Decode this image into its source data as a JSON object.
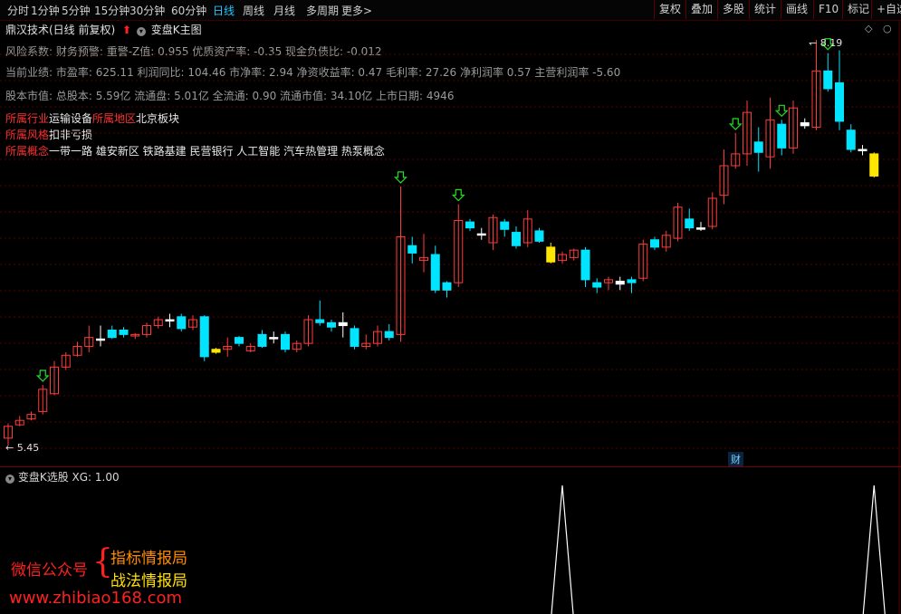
{
  "toolbar": {
    "left": [
      "分时",
      "1分钟",
      "5分钟",
      "15分钟",
      "30分钟",
      "60分钟",
      "日线",
      "周线",
      "月线",
      "多周期",
      "更多>"
    ],
    "active": "日线",
    "right": [
      "复权",
      "叠加",
      "多股",
      "统计",
      "画线",
      "F10",
      "标记",
      "+自选"
    ]
  },
  "main_title": "鼎汉技术(日线 前复权)",
  "indicator_name": "变盘K主图",
  "info": {
    "risk": "风险系数: 财务预警: 重警-Z值: 0.955 优质资产率: -0.35 现金负债比: -0.012",
    "perf": "当前业绩: 市盈率: 625.11 利润同比: 104.46 市净率: 2.94 净资收益率: 0.47 毛利率: 27.26 净利润率 0.57 主营利润率 -5.60",
    "equity": "股本市值: 总股本: 5.59亿 流通盘: 5.01亿 全流通: 0.90 流通市值: 34.10亿 上市日期: 4946"
  },
  "tags": {
    "industry_label": "所属行业",
    "industry": "运输设备",
    "region_label": "所属地区",
    "region": "北京板块",
    "style_label": "所属风格",
    "style": "扣非亏损",
    "concept_label": "所属概念",
    "concept": "一带一路 雄安新区 铁路基建 民营银行 人工智能 汽车热管理 热泵概念"
  },
  "price_high": "8.19",
  "price_low": "5.45",
  "cai_badge": "财",
  "sub_title": "变盘K选股 XG: 1.00",
  "watermark": {
    "wechat": "微信公众号",
    "brace": "{",
    "line1": "指标情报局",
    "line2": "战法情报局",
    "url": "www.zhibiao168.com"
  },
  "colors": {
    "up": "#ff3c3c",
    "down": "#00e4ff",
    "special": "#ffe600",
    "arrow": "#22dd22",
    "bg": "#000000",
    "grid": "#5a0000"
  },
  "chart_data": {
    "type": "candlestick",
    "ylim": [
      5.3,
      8.4
    ],
    "candles": [
      {
        "o": 5.5,
        "c": 5.58,
        "h": 5.6,
        "l": 5.45,
        "t": "up"
      },
      {
        "o": 5.59,
        "c": 5.62,
        "h": 5.65,
        "l": 5.58,
        "t": "up"
      },
      {
        "o": 5.63,
        "c": 5.66,
        "h": 5.68,
        "l": 5.62,
        "t": "up"
      },
      {
        "o": 5.68,
        "c": 5.83,
        "h": 5.86,
        "l": 5.66,
        "t": "up"
      },
      {
        "o": 5.8,
        "c": 5.98,
        "h": 6.02,
        "l": 5.79,
        "t": "up"
      },
      {
        "o": 5.98,
        "c": 6.06,
        "h": 6.08,
        "l": 5.96,
        "t": "up"
      },
      {
        "o": 6.06,
        "c": 6.12,
        "h": 6.15,
        "l": 6.05,
        "t": "up"
      },
      {
        "o": 6.12,
        "c": 6.18,
        "h": 6.26,
        "l": 6.08,
        "t": "up"
      },
      {
        "o": 6.17,
        "c": 6.17,
        "h": 6.26,
        "l": 6.12,
        "t": "flat"
      },
      {
        "o": 6.23,
        "c": 6.18,
        "h": 6.26,
        "l": 6.17,
        "t": "down"
      },
      {
        "o": 6.2,
        "c": 6.23,
        "h": 6.25,
        "l": 6.18,
        "t": "down"
      },
      {
        "o": 6.19,
        "c": 6.2,
        "h": 6.21,
        "l": 6.17,
        "t": "up"
      },
      {
        "o": 6.2,
        "c": 6.26,
        "h": 6.28,
        "l": 6.18,
        "t": "up"
      },
      {
        "o": 6.26,
        "c": 6.3,
        "h": 6.32,
        "l": 6.24,
        "t": "up"
      },
      {
        "o": 6.3,
        "c": 6.3,
        "h": 6.34,
        "l": 6.25,
        "t": "flat"
      },
      {
        "o": 6.32,
        "c": 6.24,
        "h": 6.34,
        "l": 6.22,
        "t": "down"
      },
      {
        "o": 6.25,
        "c": 6.3,
        "h": 6.33,
        "l": 6.23,
        "t": "up"
      },
      {
        "o": 6.32,
        "c": 6.05,
        "h": 6.33,
        "l": 6.02,
        "t": "down"
      },
      {
        "o": 6.08,
        "c": 6.1,
        "h": 6.11,
        "l": 6.07,
        "t": "special"
      },
      {
        "o": 6.1,
        "c": 6.12,
        "h": 6.18,
        "l": 6.05,
        "t": "up"
      },
      {
        "o": 6.18,
        "c": 6.14,
        "h": 6.19,
        "l": 6.12,
        "t": "down"
      },
      {
        "o": 6.09,
        "c": 6.12,
        "h": 6.14,
        "l": 6.08,
        "t": "up"
      },
      {
        "o": 6.2,
        "c": 6.12,
        "h": 6.23,
        "l": 6.11,
        "t": "down"
      },
      {
        "o": 6.18,
        "c": 6.18,
        "h": 6.22,
        "l": 6.14,
        "t": "flat"
      },
      {
        "o": 6.2,
        "c": 6.1,
        "h": 6.22,
        "l": 6.08,
        "t": "down"
      },
      {
        "o": 6.1,
        "c": 6.14,
        "h": 6.16,
        "l": 6.08,
        "t": "up"
      },
      {
        "o": 6.14,
        "c": 6.3,
        "h": 6.33,
        "l": 6.12,
        "t": "up"
      },
      {
        "o": 6.3,
        "c": 6.28,
        "h": 6.43,
        "l": 6.26,
        "t": "down"
      },
      {
        "o": 6.28,
        "c": 6.25,
        "h": 6.3,
        "l": 6.22,
        "t": "down"
      },
      {
        "o": 6.28,
        "c": 6.26,
        "h": 6.35,
        "l": 6.18,
        "t": "flat"
      },
      {
        "o": 6.24,
        "c": 6.12,
        "h": 6.26,
        "l": 6.1,
        "t": "down"
      },
      {
        "o": 6.12,
        "c": 6.14,
        "h": 6.2,
        "l": 6.1,
        "t": "up"
      },
      {
        "o": 6.14,
        "c": 6.22,
        "h": 6.26,
        "l": 6.12,
        "t": "up"
      },
      {
        "o": 6.22,
        "c": 6.18,
        "h": 6.27,
        "l": 6.16,
        "t": "down"
      },
      {
        "o": 6.2,
        "c": 6.86,
        "h": 7.2,
        "l": 6.15,
        "t": "up"
      },
      {
        "o": 6.8,
        "c": 6.75,
        "h": 6.86,
        "l": 6.68,
        "t": "down"
      },
      {
        "o": 6.7,
        "c": 6.72,
        "h": 6.88,
        "l": 6.62,
        "t": "up"
      },
      {
        "o": 6.74,
        "c": 6.5,
        "h": 6.8,
        "l": 6.48,
        "t": "down"
      },
      {
        "o": 6.55,
        "c": 6.5,
        "h": 6.56,
        "l": 6.45,
        "t": "down"
      },
      {
        "o": 6.55,
        "c": 6.97,
        "h": 7.08,
        "l": 6.52,
        "t": "up"
      },
      {
        "o": 6.96,
        "c": 6.92,
        "h": 6.98,
        "l": 6.9,
        "t": "down"
      },
      {
        "o": 6.88,
        "c": 6.88,
        "h": 6.92,
        "l": 6.84,
        "t": "flat"
      },
      {
        "o": 6.82,
        "c": 6.99,
        "h": 7.01,
        "l": 6.77,
        "t": "up"
      },
      {
        "o": 6.96,
        "c": 6.91,
        "h": 6.98,
        "l": 6.86,
        "t": "down"
      },
      {
        "o": 6.89,
        "c": 6.8,
        "h": 6.93,
        "l": 6.78,
        "t": "down"
      },
      {
        "o": 6.82,
        "c": 6.98,
        "h": 7.04,
        "l": 6.79,
        "t": "up"
      },
      {
        "o": 6.9,
        "c": 6.83,
        "h": 6.92,
        "l": 6.82,
        "t": "down"
      },
      {
        "o": 6.79,
        "c": 6.69,
        "h": 6.82,
        "l": 6.68,
        "t": "special"
      },
      {
        "o": 6.7,
        "c": 6.74,
        "h": 6.76,
        "l": 6.68,
        "t": "up"
      },
      {
        "o": 6.72,
        "c": 6.77,
        "h": 6.78,
        "l": 6.7,
        "t": "up"
      },
      {
        "o": 6.77,
        "c": 6.57,
        "h": 6.79,
        "l": 6.52,
        "t": "down"
      },
      {
        "o": 6.55,
        "c": 6.52,
        "h": 6.58,
        "l": 6.48,
        "t": "down"
      },
      {
        "o": 6.55,
        "c": 6.57,
        "h": 6.59,
        "l": 6.5,
        "t": "up"
      },
      {
        "o": 6.56,
        "c": 6.54,
        "h": 6.59,
        "l": 6.5,
        "t": "flat"
      },
      {
        "o": 6.57,
        "c": 6.55,
        "h": 6.59,
        "l": 6.48,
        "t": "down"
      },
      {
        "o": 6.58,
        "c": 6.81,
        "h": 6.84,
        "l": 6.56,
        "t": "up"
      },
      {
        "o": 6.84,
        "c": 6.79,
        "h": 6.86,
        "l": 6.77,
        "t": "down"
      },
      {
        "o": 6.79,
        "c": 6.87,
        "h": 6.9,
        "l": 6.76,
        "t": "up"
      },
      {
        "o": 6.85,
        "c": 7.06,
        "h": 7.09,
        "l": 6.83,
        "t": "up"
      },
      {
        "o": 6.98,
        "c": 6.92,
        "h": 7.05,
        "l": 6.9,
        "t": "down"
      },
      {
        "o": 6.92,
        "c": 6.92,
        "h": 6.96,
        "l": 6.9,
        "t": "flat"
      },
      {
        "o": 6.93,
        "c": 7.12,
        "h": 7.16,
        "l": 6.91,
        "t": "up"
      },
      {
        "o": 7.14,
        "c": 7.34,
        "h": 7.45,
        "l": 7.08,
        "t": "up"
      },
      {
        "o": 7.34,
        "c": 7.42,
        "h": 7.56,
        "l": 7.32,
        "t": "up"
      },
      {
        "o": 7.42,
        "c": 7.7,
        "h": 7.78,
        "l": 7.34,
        "t": "up"
      },
      {
        "o": 7.5,
        "c": 7.43,
        "h": 7.6,
        "l": 7.3,
        "t": "down"
      },
      {
        "o": 7.4,
        "c": 7.65,
        "h": 7.8,
        "l": 7.32,
        "t": "up"
      },
      {
        "o": 7.62,
        "c": 7.46,
        "h": 7.65,
        "l": 7.41,
        "t": "down"
      },
      {
        "o": 7.46,
        "c": 7.73,
        "h": 7.78,
        "l": 7.42,
        "t": "up"
      },
      {
        "o": 7.63,
        "c": 7.61,
        "h": 7.66,
        "l": 7.59,
        "t": "flat"
      },
      {
        "o": 7.6,
        "c": 7.98,
        "h": 8.19,
        "l": 7.58,
        "t": "up"
      },
      {
        "o": 7.98,
        "c": 7.86,
        "h": 8.1,
        "l": 7.84,
        "t": "down"
      },
      {
        "o": 7.9,
        "c": 7.64,
        "h": 8.12,
        "l": 7.58,
        "t": "down"
      },
      {
        "o": 7.58,
        "c": 7.45,
        "h": 7.62,
        "l": 7.43,
        "t": "down"
      },
      {
        "o": 7.45,
        "c": 7.45,
        "h": 7.48,
        "l": 7.41,
        "t": "flat"
      },
      {
        "o": 7.42,
        "c": 7.27,
        "h": 7.43,
        "l": 7.26,
        "t": "special"
      }
    ],
    "down_arrows_at": [
      3,
      34,
      39,
      63,
      67,
      71
    ],
    "xg_spikes_at": [
      48,
      75
    ]
  }
}
